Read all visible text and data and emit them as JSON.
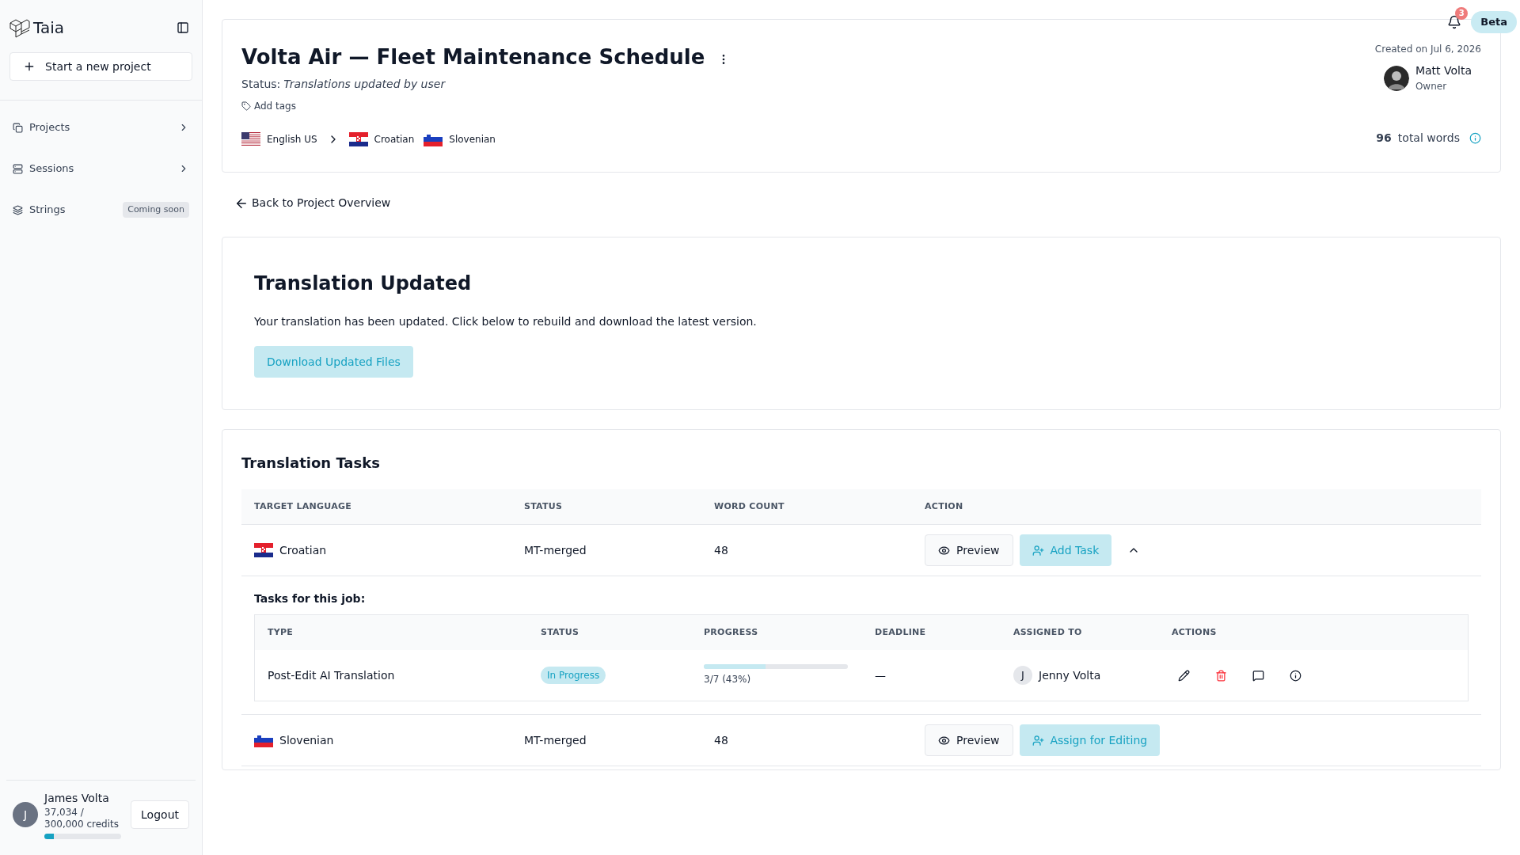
{
  "sidebar": {
    "brand": "Taia",
    "new_project": "Start a new project",
    "items": [
      {
        "label": "Projects",
        "kind": "expandable"
      },
      {
        "label": "Sessions",
        "kind": "expandable"
      },
      {
        "label": "Strings",
        "kind": "badge",
        "badge": "Coming soon"
      }
    ],
    "user": {
      "initial": "J",
      "name": "James Volta",
      "credits": "37,034 / 300,000 credits",
      "level": 0.123,
      "logout": "Logout"
    }
  },
  "topbar": {
    "notifications": "3",
    "badge": "Beta"
  },
  "project": {
    "title": "Volta Air — Fleet Maintenance Schedule",
    "status_label": "Status:",
    "status": "Translations updated by user",
    "add_tags": "Add tags",
    "source": {
      "name": "English US"
    },
    "targets": [
      {
        "name": "Croatian"
      },
      {
        "name": "Slovenian"
      }
    ],
    "created": "Created on Jul 6, 2026",
    "owner": {
      "name": "Matt Volta",
      "role": "Owner"
    },
    "word_count": "96",
    "word_label": "total words"
  },
  "back": "Back to Project Overview",
  "update": {
    "title": "Translation Updated",
    "message": "Your translation has been updated. Click below to rebuild and download the latest version.",
    "button": "Download Updated Files"
  },
  "tasks": {
    "title": "Translation Tasks",
    "columns": [
      "TARGET LANGUAGE",
      "STATUS",
      "WORD COUNT",
      "ACTION"
    ],
    "rows": [
      {
        "language": "Croatian",
        "status": "MT-merged",
        "word_count": "48",
        "preview": "Preview",
        "action": "Add Task",
        "expanded": true,
        "subtasks_title": "Tasks for this job:",
        "subcolumns": [
          "TYPE",
          "STATUS",
          "PROGRESS",
          "DEADLINE",
          "ASSIGNED TO",
          "ACTIONS"
        ],
        "subtasks": [
          {
            "type": "Post-Edit AI Translation",
            "status": "In Progress",
            "level": 0.43,
            "progress": "3/7 (43%)",
            "deadline": "—",
            "assignee_initial": "J",
            "assignee": "Jenny Volta"
          }
        ]
      },
      {
        "language": "Slovenian",
        "status": "MT-merged",
        "word_count": "48",
        "preview": "Preview",
        "action": "Assign for Editing",
        "expanded": false
      }
    ]
  }
}
